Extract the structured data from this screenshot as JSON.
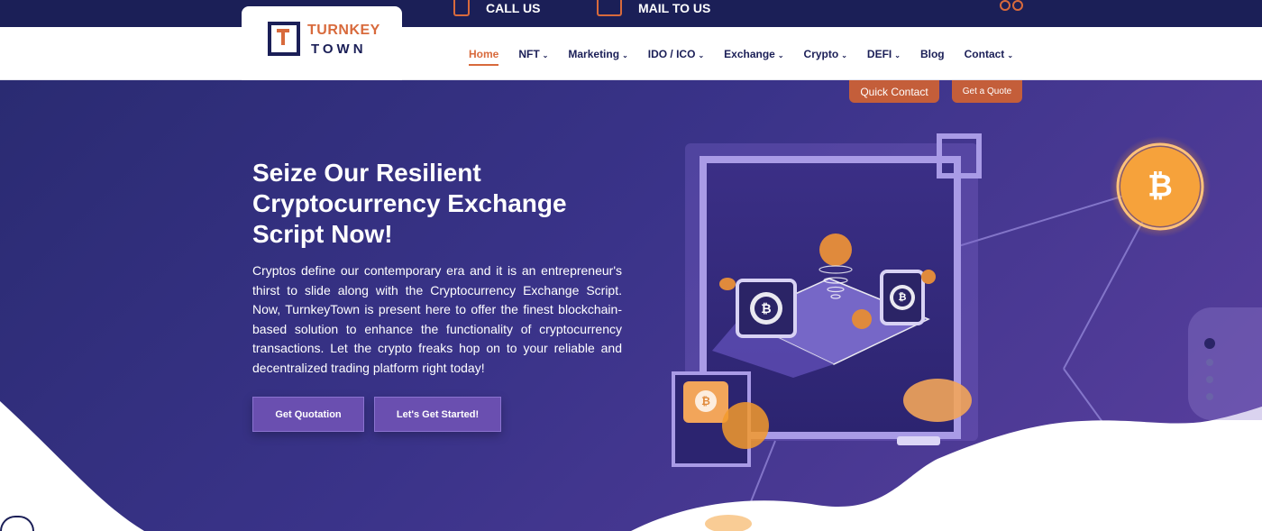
{
  "topbar": {
    "call_label": "CALL US",
    "mail_label": "MAIL TO US",
    "call_icon": "phone-icon",
    "mail_icon": "mail-icon",
    "access_icon": "glasses-icon"
  },
  "logo": {
    "line1": "TURNKEY",
    "line2": "TOWN"
  },
  "nav": {
    "items": [
      {
        "label": "Home",
        "dropdown": false,
        "active": true
      },
      {
        "label": "NFT",
        "dropdown": true
      },
      {
        "label": "Marketing",
        "dropdown": true
      },
      {
        "label": "IDO / ICO",
        "dropdown": true
      },
      {
        "label": "Exchange",
        "dropdown": true
      },
      {
        "label": "Crypto",
        "dropdown": true
      },
      {
        "label": "DEFI",
        "dropdown": true
      },
      {
        "label": "Blog",
        "dropdown": false
      },
      {
        "label": "Contact",
        "dropdown": true
      }
    ],
    "caret": "⌄"
  },
  "hero": {
    "quick_contact": "Quick Contact",
    "get_quote": "Get a Quote",
    "title": "Seize Our Resilient Cryptocurrency Exchange Script Now!",
    "description": "Cryptos define our contemporary era and it is an entrepreneur's thirst to slide along with the Cryptocurrency Exchange Script. Now, TurnkeyTown is present here to offer the finest blockchain-based solution to enhance the functionality of cryptocurrency transactions. Let the crypto freaks hop on to your reliable and decentralized trading platform right today!",
    "btn_quotation": "Get Quotation",
    "btn_started": "Let's Get Started!",
    "bitcoin_symbol": "₿"
  },
  "colors": {
    "navy": "#1b1f57",
    "accent": "#d86a3c",
    "hero_purple": "#3a3389"
  }
}
